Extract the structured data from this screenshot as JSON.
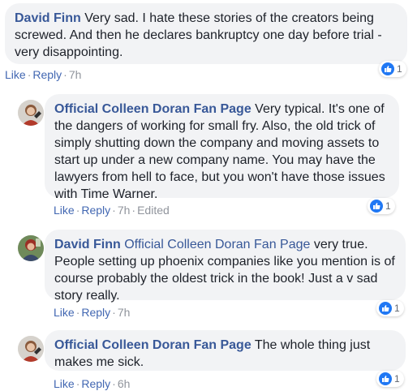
{
  "colors": {
    "link": "#385898",
    "action": "#4267b2",
    "meta": "#90949c",
    "bubble": "#f2f3f5",
    "like": "#2078f4"
  },
  "comments": [
    {
      "author": "David Finn",
      "text_line1": " Very sad. I hate these stories of the creators being",
      "text_line2": "screwed. And then he declares bankruptcy one day before trial -",
      "text_line3": "very disappointing.",
      "like": "Like",
      "reply": "Reply",
      "time": "7h",
      "reactions": "1",
      "reaction_icon": "like-thumb-icon"
    },
    {
      "author": "Official Colleen Doran Fan Page",
      "text_line1": " Very typical. It's one of",
      "text_line2": "the dangers of working for small fry. Also, the old trick of",
      "text_line3": "simply shutting down the company and moving assets to",
      "text_line4": "start up under a new company name. You may have the",
      "text_line5": "lawyers from hell to face, but you won't have those issues",
      "text_line6": "with Time Warner.",
      "like": "Like",
      "reply": "Reply",
      "time": "7h",
      "edited": "Edited",
      "reactions": "1",
      "reaction_icon": "like-thumb-icon",
      "avatar_icon": "colleen-doran-avatar"
    },
    {
      "author": "David Finn",
      "mention": "Official Colleen Doran Fan Page",
      "text_line1": " very true.",
      "text_line2": "People setting up phoenix companies like you mention is of",
      "text_line3": "course probably the oldest trick in the book! Just a v sad",
      "text_line4": "story really.",
      "like": "Like",
      "reply": "Reply",
      "time": "7h",
      "reactions": "1",
      "reaction_icon": "like-thumb-icon",
      "avatar_icon": "david-finn-avatar"
    },
    {
      "author": "Official Colleen Doran Fan Page",
      "text_line1": " The whole thing just",
      "text_line2": "makes me sick.",
      "like": "Like",
      "reply": "Reply",
      "time": "6h",
      "reactions": "1",
      "reaction_icon": "like-thumb-icon",
      "avatar_icon": "colleen-doran-avatar"
    }
  ]
}
